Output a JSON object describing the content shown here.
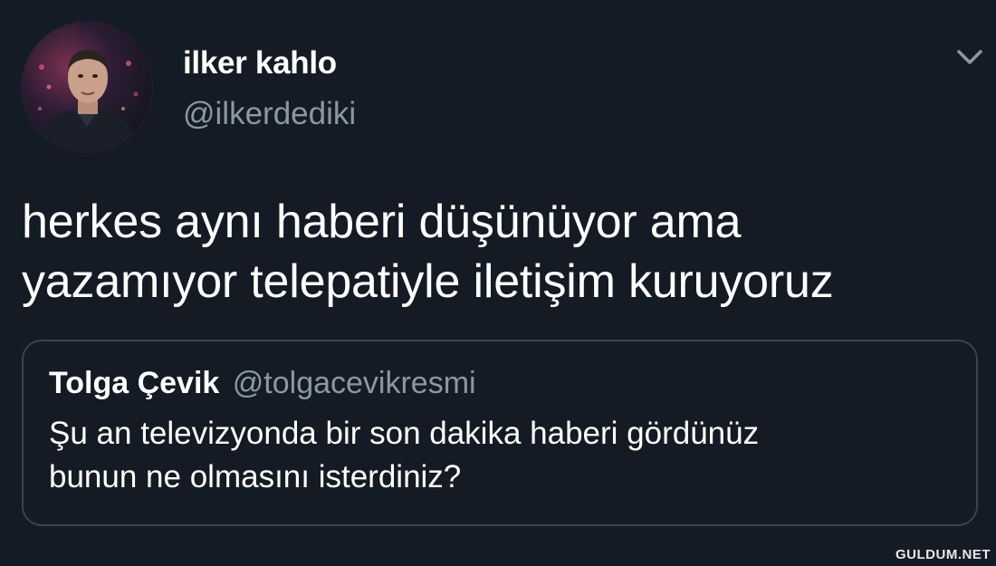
{
  "tweet": {
    "author": {
      "display_name": "ilker kahlo",
      "handle": "@ilkerdediki"
    },
    "text_lines": [
      "herkes aynı haberi düşünüyor ama",
      "yazamıyor telepatiyle iletişim kuruyoruz"
    ],
    "menu_icon": "chevron-down-icon"
  },
  "quoted_tweet": {
    "display_name": "Tolga Çevik",
    "handle": "@tolgacevikresmi",
    "text_lines": [
      "Şu an televizyonda bir son dakika haberi gördünüz",
      "bunun ne olmasını isterdiniz?"
    ]
  },
  "watermark": "GULDUM.NET",
  "colors": {
    "background": "#151b24",
    "primary_text": "#ffffff",
    "secondary_text": "#8899a6",
    "border": "#38444d"
  }
}
